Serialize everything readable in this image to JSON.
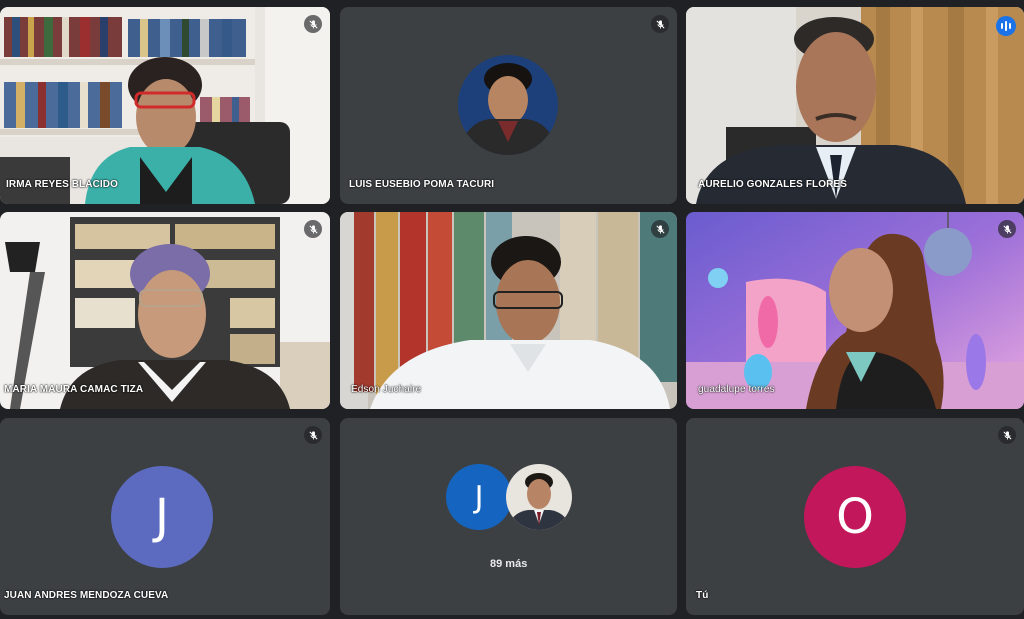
{
  "participants": [
    {
      "name": "IRMA REYES BLACIDO",
      "muted": true
    },
    {
      "name": "LUIS EUSEBIO POMA TACURI",
      "muted": true
    },
    {
      "name": "AURELIO GONZALES FLORES",
      "muted": false,
      "speaking": true
    },
    {
      "name": "MARIA MAURA CAMAC TIZA",
      "muted": true
    },
    {
      "name": "Edson Juchaire",
      "muted": true
    },
    {
      "name": "guadalupe torres",
      "muted": true
    },
    {
      "name": "JUAN ANDRES MENDOZA CUEVA",
      "muted": true,
      "initial": "J",
      "color": "#5c6bc0"
    },
    {
      "more_label": "89 más",
      "initial": "J",
      "color": "#1565c0"
    },
    {
      "name": "Tú",
      "muted": true,
      "initial": "O",
      "color": "#c2185b"
    }
  ],
  "icons": {
    "muted": "mic-off-icon",
    "speaking": "audio-level-icon"
  },
  "colors": {
    "background": "#202124",
    "tile": "#3c4043",
    "speaking_border": "#8ab4f8"
  }
}
